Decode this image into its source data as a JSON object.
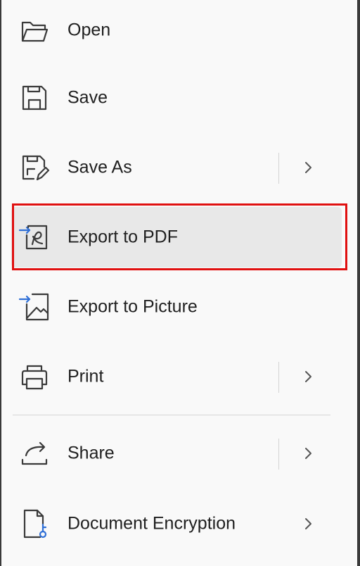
{
  "menu": {
    "items": [
      {
        "label": "Open",
        "icon": "folder-open-icon",
        "has_submenu": false
      },
      {
        "label": "Save",
        "icon": "save-icon",
        "has_submenu": false
      },
      {
        "label": "Save As",
        "icon": "save-as-icon",
        "has_submenu": true
      },
      {
        "label": "Export to PDF",
        "icon": "export-pdf-icon",
        "has_submenu": false,
        "selected": true
      },
      {
        "label": "Export to Picture",
        "icon": "export-picture-icon",
        "has_submenu": false
      },
      {
        "label": "Print",
        "icon": "printer-icon",
        "has_submenu": true
      },
      {
        "label": "Share",
        "icon": "share-icon",
        "has_submenu": true
      },
      {
        "label": "Document Encryption",
        "icon": "document-encryption-icon",
        "has_submenu": true
      }
    ]
  },
  "colors": {
    "highlight_border": "#e01010",
    "selected_background": "#e8e8e8",
    "icon_accent": "#2f6fd6",
    "background": "#f9f9f9"
  }
}
